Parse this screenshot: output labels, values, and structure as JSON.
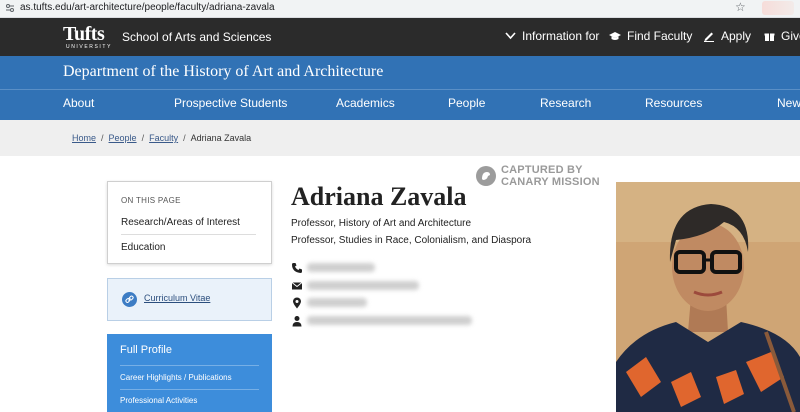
{
  "browser": {
    "url": "as.tufts.edu/art-architecture/people/faculty/adriana-zavala"
  },
  "topbar": {
    "logo_text": "Tufts",
    "logo_sub": "UNIVERSITY",
    "school": "School of Arts and Sciences",
    "links": {
      "info": "Information for",
      "find": "Find Faculty",
      "apply": "Apply",
      "give": "Give"
    }
  },
  "department": {
    "title": "Department of the History of Art and Architecture",
    "nav": [
      "About",
      "Prospective Students",
      "Academics",
      "People",
      "Research",
      "Resources",
      "New"
    ]
  },
  "breadcrumb": {
    "home": "Home",
    "people": "People",
    "faculty": "Faculty",
    "current": "Adriana Zavala"
  },
  "sidebar": {
    "on_this_page_heading": "ON THIS PAGE",
    "on_this_page_items": [
      "Research/Areas of Interest",
      "Education"
    ],
    "cv_label": "Curriculum Vitae",
    "full_profile": {
      "title": "Full Profile",
      "items": [
        "Career Highlights / Publications",
        "Professional Activities"
      ]
    }
  },
  "profile": {
    "name": "Adriana Zavala",
    "titles": [
      "Professor, History of Art and Architecture",
      "Professor, Studies in Race, Colonialism, and Diaspora"
    ]
  },
  "watermark": {
    "line1": "CAPTURED BY",
    "line2": "CANARY MISSION"
  },
  "colors": {
    "topbar": "#2b2b2b",
    "department_bar": "#3172b5",
    "full_profile_bg": "#3d8ddb",
    "breadcrumb_bg": "#efefef"
  },
  "icons": {
    "phone": "phone-icon",
    "email": "email-icon",
    "location": "location-pin-icon",
    "person": "person-icon",
    "link": "link-icon"
  }
}
